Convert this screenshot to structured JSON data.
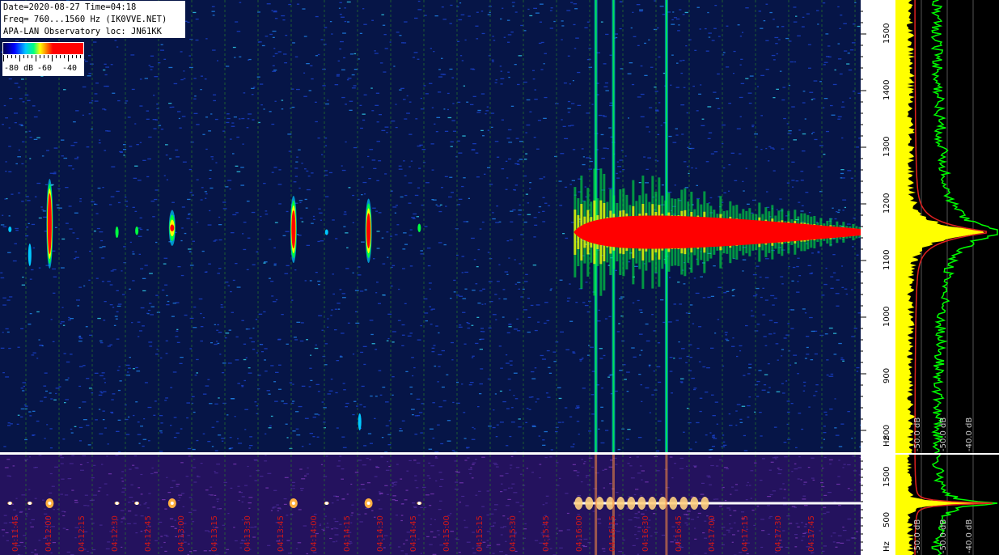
{
  "header": {
    "line1": "Date=2020-08-27 Time=04:18",
    "line2": "Freq= 760...1560 Hz (IK0VVE.NET)",
    "line3": "APA-LAN Observatory loc: JN61KK"
  },
  "scale": {
    "labels": [
      "-80 dB",
      "-60",
      "-40"
    ]
  },
  "colors": {
    "spectrogram_bg": "#061547",
    "lowband_bg": "#24125e",
    "signal_red": "#ff0000",
    "signal_yellow": "#ffff00",
    "signal_green": "#00ff40",
    "signal_cyan": "#00c8ff",
    "grid_green": "#2a7a2a",
    "time_label_red": "#d01818",
    "profile_yellow": "#ffff00",
    "profile_green": "#00ff00",
    "profile_red": "#e02020"
  },
  "chart_data": [
    {
      "type": "heatmap",
      "name_printed": "",
      "title": "",
      "y_axis_label": "Hz",
      "ylim": [
        760,
        1560
      ],
      "y_ticks": [
        800,
        900,
        1000,
        1100,
        1200,
        1300,
        1400,
        1500
      ],
      "time_labels": [
        "04:11:45",
        "04:12:00",
        "04:12:15",
        "04:12:30",
        "04:12:45",
        "04:13:00",
        "04:13:15",
        "04:13:30",
        "04:13:45",
        "04:14:00",
        "04:14:15",
        "04:14:30",
        "04:14:45",
        "04:15:00",
        "04:15:15",
        "04:15:30",
        "04:15:45",
        "04:16:00",
        "04:16:15",
        "04:16:30",
        "04:16:45",
        "04:17:00",
        "04:17:15",
        "04:17:30",
        "04:17:45"
      ],
      "time_range_s": [
        0,
        390
      ],
      "carrier_hz": 1150,
      "events": [
        {
          "t": 4.5,
          "f_low": 1150,
          "f_high": 1160,
          "level": "cyan"
        },
        {
          "t": 13.5,
          "f_low": 1090,
          "f_high": 1130,
          "level": "cyan"
        },
        {
          "t": 22.5,
          "f_low": 1100,
          "f_high": 1230,
          "level": "red"
        },
        {
          "t": 53,
          "f_low": 1140,
          "f_high": 1160,
          "level": "green"
        },
        {
          "t": 62,
          "f_low": 1145,
          "f_high": 1160,
          "level": "green"
        },
        {
          "t": 78,
          "f_low": 1140,
          "f_high": 1175,
          "level": "red"
        },
        {
          "t": 133,
          "f_low": 1110,
          "f_high": 1200,
          "level": "red"
        },
        {
          "t": 148,
          "f_low": 1145,
          "f_high": 1155,
          "level": "cyan"
        },
        {
          "t": 167,
          "f_low": 1110,
          "f_high": 1195,
          "level": "red"
        },
        {
          "t": 163,
          "f_low": 800,
          "f_high": 830,
          "level": "cyan"
        },
        {
          "t": 190,
          "f_low": 1150,
          "f_high": 1165,
          "level": "green"
        }
      ],
      "persistent_signals": [
        {
          "t_start": 260,
          "t_end": 390,
          "f_low": 1120,
          "f_high": 1160,
          "level": "red",
          "description_none": ""
        }
      ],
      "vertical_streaks": [
        {
          "t": 270,
          "f_low": 760,
          "f_high": 1560
        },
        {
          "t": 278,
          "f_low": 760,
          "f_high": 1560
        },
        {
          "t": 302,
          "f_low": 760,
          "f_high": 1560
        }
      ]
    },
    {
      "type": "heatmap",
      "title": "",
      "y_axis_label": "Hz",
      "y_ticks": [
        500,
        1500
      ],
      "carrier_hz": 1150
    },
    {
      "type": "line",
      "title": "",
      "x_tick_labels": [
        "-50.0 dB",
        "-50.0 dB",
        "-40.0 dB"
      ],
      "series_count": 3
    },
    {
      "type": "line",
      "title": "",
      "x_tick_labels": [
        "-50.0 dB",
        "-50.0 dB",
        "-40.0 dB"
      ],
      "series_count": 3
    }
  ]
}
